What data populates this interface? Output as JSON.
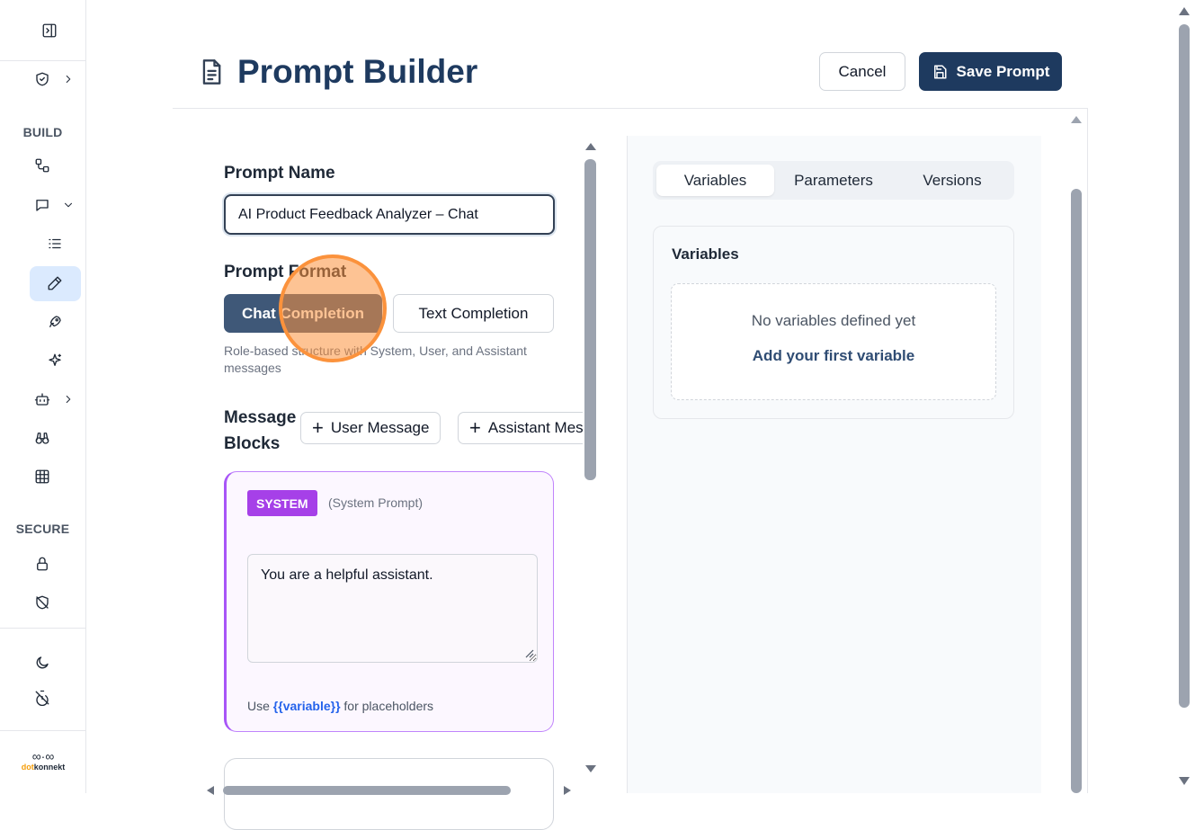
{
  "sidebar": {
    "sections": {
      "build": "BUILD",
      "secure": "SECURE"
    },
    "icons": [
      "panel-toggle-icon",
      "shield-check-icon",
      "workflow-icon",
      "chat-icon",
      "list-icon",
      "pencil-icon",
      "rocket-icon",
      "sparkle-icon",
      "bot-icon",
      "binoculars-icon",
      "grid-icon",
      "lock-icon",
      "shield-off-icon",
      "moon-icon",
      "timer-off-icon"
    ],
    "logo": {
      "brand": "konnekt",
      "prefix": "dot"
    }
  },
  "header": {
    "title": "Prompt Builder",
    "cancel_label": "Cancel",
    "save_label": "Save Prompt"
  },
  "editor": {
    "prompt_name_label": "Prompt Name",
    "prompt_name_value": "AI Product Feedback Analyzer – Chat",
    "format_label": "Prompt Format",
    "format_options": {
      "chat": "Chat Completion",
      "text": "Text Completion"
    },
    "selected_format": "Chat Completion",
    "format_description": "Role-based structure with System, User, and Assistant messages",
    "message_blocks_label": "Message Blocks",
    "add_user_label": "User Message",
    "add_assistant_label": "Assistant Message",
    "system_block": {
      "badge": "SYSTEM",
      "subtitle": "(System Prompt)",
      "content": "You are a helpful assistant.",
      "hint_prefix": "Use ",
      "hint_var": "{{variable}}",
      "hint_suffix": " for placeholders"
    }
  },
  "side_panel": {
    "tabs": [
      "Variables",
      "Parameters",
      "Versions"
    ],
    "active_tab": "Variables",
    "variables": {
      "title": "Variables",
      "empty_text": "No variables defined yet",
      "add_label": "Add your first variable"
    }
  },
  "colors": {
    "primary": "#1e3a5f",
    "system_accent": "#a855f7",
    "click_highlight": "#fb923c"
  }
}
